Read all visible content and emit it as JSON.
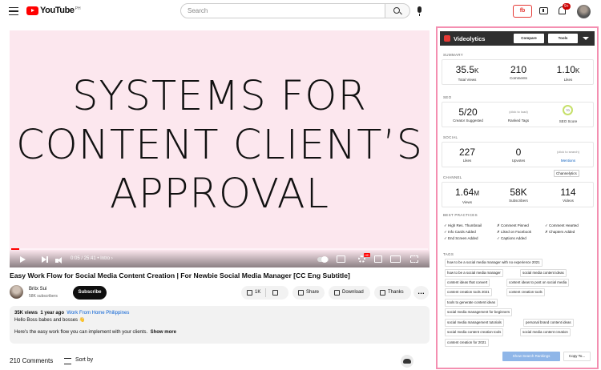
{
  "header": {
    "logo_text": "YouTube",
    "logo_country": "PH",
    "search_placeholder": "Search",
    "notification_count": "9+",
    "videolytics_icon_text": "fb"
  },
  "video": {
    "overlay_lines": [
      "SYSTEMS FOR",
      "CONTENT CLIENT’S",
      "APPROVAL"
    ],
    "time": "0:05 / 25:41 • Intro ›",
    "progress": 0.02,
    "title": "Easy Work Flow for Social Media Content Creation | For Newbie Social Media Manager [CC Eng Subtitle]",
    "hd_badge": "HD"
  },
  "channel": {
    "name": "Britx Sui",
    "subscribers": "58K subscribers",
    "subscribe_label": "Subscribe"
  },
  "actions": {
    "likes": "1K",
    "share": "Share",
    "download": "Download",
    "thanks": "Thanks",
    "more": "…"
  },
  "description": {
    "views": "35K views",
    "age": "1 year ago",
    "location": "Work From Home Philippines",
    "line1": "Hello Boss babes and bosses 👋",
    "line2": "Here's the easy work flow you can implement with your clients.",
    "show_more": "Show more"
  },
  "comments": {
    "count": "210 Comments",
    "sort_label": "Sort by"
  },
  "panel": {
    "title": "Videolytics",
    "compare": "Compare",
    "tools": "Tools",
    "summary": {
      "label": "SUMMARY",
      "views": "35.5",
      "views_unit": "K",
      "views_label": "Total Views",
      "comments": "210",
      "comments_label": "Comments",
      "likes": "1.10",
      "likes_unit": "K",
      "likes_label": "Likes"
    },
    "seo": {
      "label": "SEO",
      "suggested": "5/20",
      "suggested_label": "Creator Suggested",
      "ranked_note": "(click to load)",
      "ranked_label": "Ranked Tags",
      "score": "70",
      "score_label": "SEO Score"
    },
    "social": {
      "label": "SOCIAL",
      "likes": "227",
      "likes_label": "Likes",
      "upvotes": "0",
      "upvotes_label": "Upvotes",
      "mentions_note": "(click to search)",
      "mentions_label": "Mentions"
    },
    "channel": {
      "label": "CHANNEL",
      "channelytics": "Channelytics",
      "views": "1.64",
      "views_unit": "M",
      "views_label": "Views",
      "subs": "58K",
      "subs_label": "Subscribers",
      "videos": "114",
      "videos_label": "Videos"
    },
    "best_practices": {
      "label": "BEST PRACTICES",
      "items": [
        "✓ High Res. Thumbnail",
        "✗ Comment Pinned",
        "✓ Comment Hearted",
        "✓ Info Cards Added",
        "✗ Liked on Facebook",
        "✗ Chapters Added",
        "✓ End Screen Added",
        "✓ Captions Added"
      ]
    },
    "tags": {
      "label": "TAGS",
      "items": [
        "how to be a social media manager with no experience 2021",
        "how to be a social media manager",
        "social media content ideas",
        "content ideas that convert",
        "content ideas to post on social media",
        "content creation tools 2021",
        "content creation tools",
        "tools to generate content ideas",
        "social media management for beginners",
        "social media management tutorials",
        "personal brand content ideas",
        "social media content creation tools",
        "social media content creation",
        "content creation for 2021"
      ]
    },
    "show_rankings": "Show Search Rankings",
    "copy": "Copy To..."
  }
}
